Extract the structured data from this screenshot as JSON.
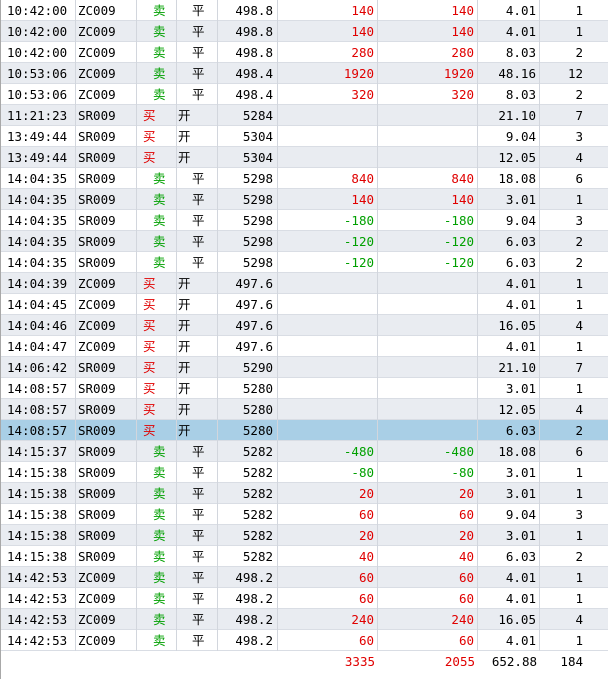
{
  "columns": [
    "time",
    "code",
    "direction",
    "open_close",
    "price",
    "pl_a",
    "pl_b",
    "fee",
    "qty"
  ],
  "colors": {
    "buy": "#e00000",
    "sell": "#00a000",
    "selected_row": "#a9cfe6",
    "alt_row": "#e9ecf1"
  },
  "rows": [
    {
      "time": "10:42:00",
      "code": "ZC009",
      "dir": "卖",
      "oc": "平",
      "price": "498.8",
      "pl_a": "140",
      "pl_b": "140",
      "fee": "4.01",
      "qty": "1"
    },
    {
      "time": "10:42:00",
      "code": "ZC009",
      "dir": "卖",
      "oc": "平",
      "price": "498.8",
      "pl_a": "140",
      "pl_b": "140",
      "fee": "4.01",
      "qty": "1"
    },
    {
      "time": "10:42:00",
      "code": "ZC009",
      "dir": "卖",
      "oc": "平",
      "price": "498.8",
      "pl_a": "280",
      "pl_b": "280",
      "fee": "8.03",
      "qty": "2"
    },
    {
      "time": "10:53:06",
      "code": "ZC009",
      "dir": "卖",
      "oc": "平",
      "price": "498.4",
      "pl_a": "1920",
      "pl_b": "1920",
      "fee": "48.16",
      "qty": "12"
    },
    {
      "time": "10:53:06",
      "code": "ZC009",
      "dir": "卖",
      "oc": "平",
      "price": "498.4",
      "pl_a": "320",
      "pl_b": "320",
      "fee": "8.03",
      "qty": "2"
    },
    {
      "time": "11:21:23",
      "code": "SR009",
      "dir": "买",
      "oc": "开",
      "price": "5284",
      "pl_a": "",
      "pl_b": "",
      "fee": "21.10",
      "qty": "7"
    },
    {
      "time": "13:49:44",
      "code": "SR009",
      "dir": "买",
      "oc": "开",
      "price": "5304",
      "pl_a": "",
      "pl_b": "",
      "fee": "9.04",
      "qty": "3"
    },
    {
      "time": "13:49:44",
      "code": "SR009",
      "dir": "买",
      "oc": "开",
      "price": "5304",
      "pl_a": "",
      "pl_b": "",
      "fee": "12.05",
      "qty": "4"
    },
    {
      "time": "14:04:35",
      "code": "SR009",
      "dir": "卖",
      "oc": "平",
      "price": "5298",
      "pl_a": "840",
      "pl_b": "840",
      "fee": "18.08",
      "qty": "6"
    },
    {
      "time": "14:04:35",
      "code": "SR009",
      "dir": "卖",
      "oc": "平",
      "price": "5298",
      "pl_a": "140",
      "pl_b": "140",
      "fee": "3.01",
      "qty": "1"
    },
    {
      "time": "14:04:35",
      "code": "SR009",
      "dir": "卖",
      "oc": "平",
      "price": "5298",
      "pl_a": "-180",
      "pl_b": "-180",
      "fee": "9.04",
      "qty": "3"
    },
    {
      "time": "14:04:35",
      "code": "SR009",
      "dir": "卖",
      "oc": "平",
      "price": "5298",
      "pl_a": "-120",
      "pl_b": "-120",
      "fee": "6.03",
      "qty": "2"
    },
    {
      "time": "14:04:35",
      "code": "SR009",
      "dir": "卖",
      "oc": "平",
      "price": "5298",
      "pl_a": "-120",
      "pl_b": "-120",
      "fee": "6.03",
      "qty": "2"
    },
    {
      "time": "14:04:39",
      "code": "ZC009",
      "dir": "买",
      "oc": "开",
      "price": "497.6",
      "pl_a": "",
      "pl_b": "",
      "fee": "4.01",
      "qty": "1"
    },
    {
      "time": "14:04:45",
      "code": "ZC009",
      "dir": "买",
      "oc": "开",
      "price": "497.6",
      "pl_a": "",
      "pl_b": "",
      "fee": "4.01",
      "qty": "1"
    },
    {
      "time": "14:04:46",
      "code": "ZC009",
      "dir": "买",
      "oc": "开",
      "price": "497.6",
      "pl_a": "",
      "pl_b": "",
      "fee": "16.05",
      "qty": "4"
    },
    {
      "time": "14:04:47",
      "code": "ZC009",
      "dir": "买",
      "oc": "开",
      "price": "497.6",
      "pl_a": "",
      "pl_b": "",
      "fee": "4.01",
      "qty": "1"
    },
    {
      "time": "14:06:42",
      "code": "SR009",
      "dir": "买",
      "oc": "开",
      "price": "5290",
      "pl_a": "",
      "pl_b": "",
      "fee": "21.10",
      "qty": "7"
    },
    {
      "time": "14:08:57",
      "code": "SR009",
      "dir": "买",
      "oc": "开",
      "price": "5280",
      "pl_a": "",
      "pl_b": "",
      "fee": "3.01",
      "qty": "1"
    },
    {
      "time": "14:08:57",
      "code": "SR009",
      "dir": "买",
      "oc": "开",
      "price": "5280",
      "pl_a": "",
      "pl_b": "",
      "fee": "12.05",
      "qty": "4"
    },
    {
      "time": "14:08:57",
      "code": "SR009",
      "dir": "买",
      "oc": "开",
      "price": "5280",
      "pl_a": "",
      "pl_b": "",
      "fee": "6.03",
      "qty": "2",
      "selected": true
    },
    {
      "time": "14:15:37",
      "code": "SR009",
      "dir": "卖",
      "oc": "平",
      "price": "5282",
      "pl_a": "-480",
      "pl_b": "-480",
      "fee": "18.08",
      "qty": "6"
    },
    {
      "time": "14:15:38",
      "code": "SR009",
      "dir": "卖",
      "oc": "平",
      "price": "5282",
      "pl_a": "-80",
      "pl_b": "-80",
      "fee": "3.01",
      "qty": "1"
    },
    {
      "time": "14:15:38",
      "code": "SR009",
      "dir": "卖",
      "oc": "平",
      "price": "5282",
      "pl_a": "20",
      "pl_b": "20",
      "fee": "3.01",
      "qty": "1"
    },
    {
      "time": "14:15:38",
      "code": "SR009",
      "dir": "卖",
      "oc": "平",
      "price": "5282",
      "pl_a": "60",
      "pl_b": "60",
      "fee": "9.04",
      "qty": "3"
    },
    {
      "time": "14:15:38",
      "code": "SR009",
      "dir": "卖",
      "oc": "平",
      "price": "5282",
      "pl_a": "20",
      "pl_b": "20",
      "fee": "3.01",
      "qty": "1"
    },
    {
      "time": "14:15:38",
      "code": "SR009",
      "dir": "卖",
      "oc": "平",
      "price": "5282",
      "pl_a": "40",
      "pl_b": "40",
      "fee": "6.03",
      "qty": "2"
    },
    {
      "time": "14:42:53",
      "code": "ZC009",
      "dir": "卖",
      "oc": "平",
      "price": "498.2",
      "pl_a": "60",
      "pl_b": "60",
      "fee": "4.01",
      "qty": "1"
    },
    {
      "time": "14:42:53",
      "code": "ZC009",
      "dir": "卖",
      "oc": "平",
      "price": "498.2",
      "pl_a": "60",
      "pl_b": "60",
      "fee": "4.01",
      "qty": "1"
    },
    {
      "time": "14:42:53",
      "code": "ZC009",
      "dir": "卖",
      "oc": "平",
      "price": "498.2",
      "pl_a": "240",
      "pl_b": "240",
      "fee": "16.05",
      "qty": "4"
    },
    {
      "time": "14:42:53",
      "code": "ZC009",
      "dir": "卖",
      "oc": "平",
      "price": "498.2",
      "pl_a": "60",
      "pl_b": "60",
      "fee": "4.01",
      "qty": "1"
    }
  ],
  "totals": {
    "pl_a": "3335",
    "pl_b": "2055",
    "fee": "652.88",
    "qty": "184"
  }
}
